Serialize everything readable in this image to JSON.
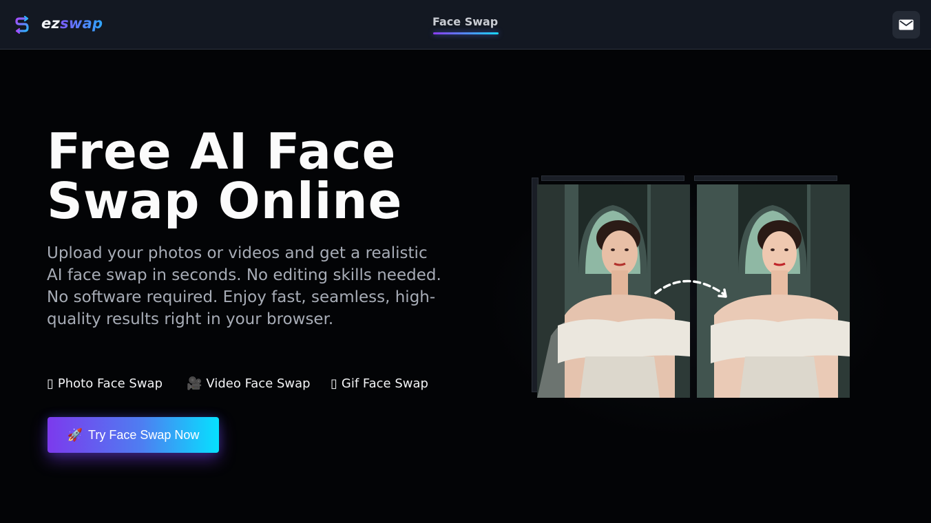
{
  "brand": {
    "name_part1": "ez",
    "name_part2": "swap"
  },
  "nav": {
    "active_tab": "Face Swap",
    "mail_icon": "mail-icon"
  },
  "hero": {
    "title": "Free AI Face Swap Online",
    "description": "Upload your photos or videos and get a realistic AI face swap in seconds. No editing skills needed. No software required. Enjoy fast, seamless, high-quality results right in your browser.",
    "features": [
      {
        "icon": "▯",
        "label": "Photo Face Swap"
      },
      {
        "icon": "🎥",
        "label": "Video Face Swap"
      },
      {
        "icon": "▯",
        "label": "Gif Face Swap"
      }
    ],
    "cta_label": "Try Face Swap Now",
    "cta_icon": "🚀"
  },
  "preview": {
    "source_image_name": "original-portrait",
    "result_image_name": "swapped-portrait",
    "arrow_icon": "swap-arrow-icon"
  },
  "colors": {
    "accent_start": "#7c3aed",
    "accent_end": "#06e1ff",
    "background": "#030406",
    "navbar": "#131822"
  }
}
